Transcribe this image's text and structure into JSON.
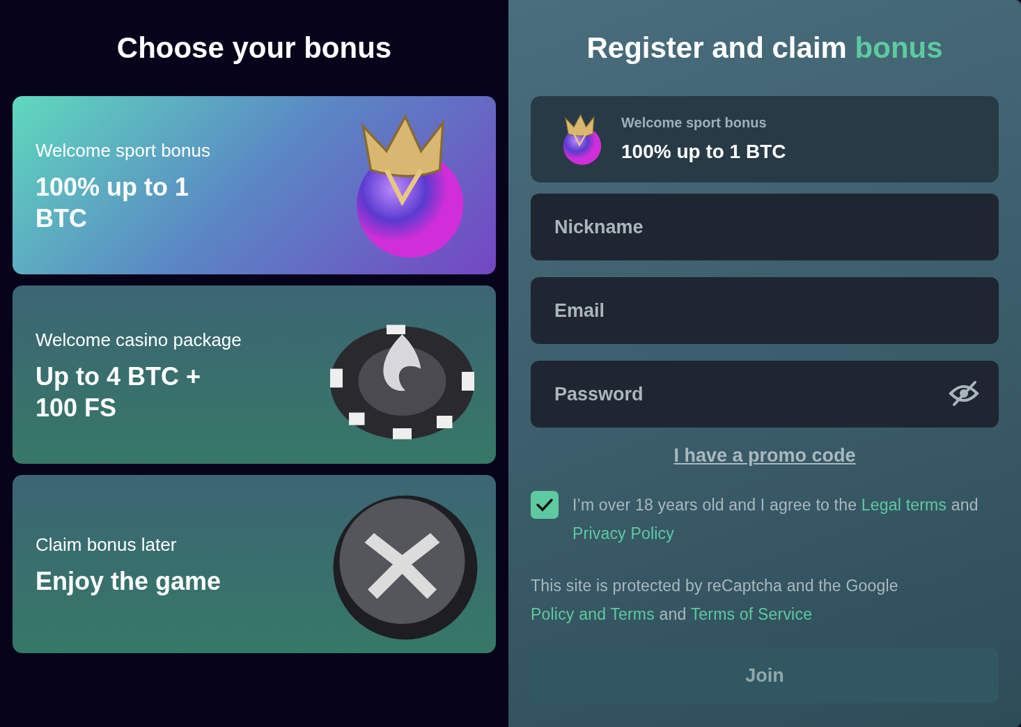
{
  "left": {
    "title": "Choose your bonus",
    "bonuses": [
      {
        "kind": "sport",
        "subtitle": "Welcome sport bonus",
        "title": "100% up to 1 BTC",
        "selected": true
      },
      {
        "kind": "casino",
        "subtitle": "Welcome casino package",
        "title": "Up to 4 BTC + 100 FS",
        "selected": false
      },
      {
        "kind": "later",
        "subtitle": "Claim bonus later",
        "title": "Enjoy the game",
        "selected": false
      }
    ]
  },
  "right": {
    "title": [
      {
        "text": "Register and claim ",
        "accent": false
      },
      {
        "text": "bonus",
        "accent": true
      }
    ],
    "chosen_bonus": {
      "kind": "sport",
      "subtitle": "Welcome sport bonus",
      "title": "100% up to 1 BTC"
    },
    "fields": [
      {
        "placeholder": "Nickname",
        "kind": "text"
      },
      {
        "placeholder": "Email",
        "kind": "email"
      },
      {
        "placeholder": "Password",
        "kind": "password"
      }
    ],
    "promo_link": "I have a promo code",
    "agreement": {
      "checked": true,
      "parts": [
        {
          "text": "I’m over 18 years old and I agree to the ",
          "link": false
        },
        {
          "text": "Legal terms",
          "link": true
        },
        {
          "text": " and ",
          "link": false
        },
        {
          "text": "Privacy Policy",
          "link": true
        }
      ]
    },
    "recaptcha": [
      {
        "text": "This site is protected by reCaptcha and the Google ",
        "link": false
      },
      {
        "text": "Policy and Terms",
        "link": true
      },
      {
        "text": " and ",
        "link": false
      },
      {
        "text": "Terms of Service",
        "link": true
      }
    ],
    "join_button": {
      "label": "Join",
      "disabled": true
    }
  }
}
